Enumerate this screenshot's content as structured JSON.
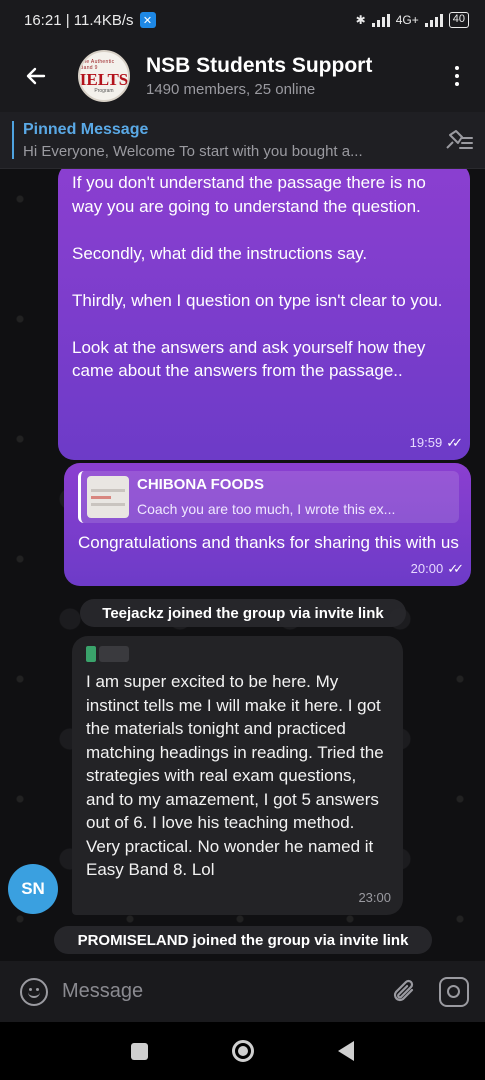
{
  "status_bar": {
    "time_speed": "16:21 | 11.4KB/s",
    "network": "4G+",
    "battery": "40"
  },
  "header": {
    "avatar_text": {
      "top": "The Authentic Band 9",
      "main": "IELTS",
      "bottom": "Program"
    },
    "title": "NSB Students Support",
    "subtitle": "1490 members, 25 online"
  },
  "pinned": {
    "title": "Pinned Message",
    "text": "Hi Everyone,   Welcome   To start with you bought a..."
  },
  "messages": {
    "m1": {
      "lines": [
        "If you don't understand the passage there is no way you are going to understand the question.",
        "Secondly, what did the instructions say.",
        "Thirdly, when I question on type isn't clear to you.",
        "Look at the answers and ask yourself how they came about the answers from the passage.."
      ],
      "time": "19:59"
    },
    "m2": {
      "reply_name": "CHIBONA FOODS",
      "reply_text": "Coach you  are too much, I wrote this ex...",
      "text": "Congratulations and thanks for sharing this with us",
      "time": "20:00"
    },
    "service1": "Teejackz joined the group via invite link",
    "m3": {
      "sender": "S",
      "text": "I am super excited to be here. My instinct tells me I will make it here. I got the materials tonight and practiced matching headings in reading. Tried the strategies with real exam questions, and to my amazement, I got 5 answers out of 6. I love his teaching method. Very practical. No wonder he named it Easy Band 8. Lol",
      "time": "23:00",
      "avatar": "SN"
    },
    "service2": "PROMISELAND joined the group via invite link"
  },
  "composer": {
    "placeholder": "Message"
  },
  "colors": {
    "outgoing_bubble": "#7b3fcf",
    "incoming_bubble": "#232326",
    "accent": "#5aa9e6",
    "avatar_sn": "#3aa0e0"
  }
}
